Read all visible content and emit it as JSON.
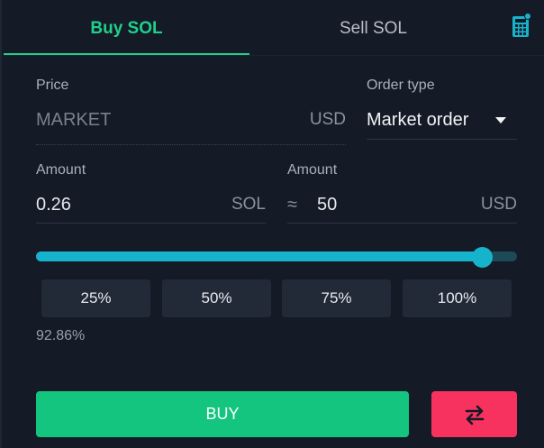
{
  "tabs": [
    {
      "label": "Buy SOL",
      "active": true
    },
    {
      "label": "Sell SOL",
      "active": false
    }
  ],
  "calculator_icon": "calculator-icon",
  "price": {
    "label": "Price",
    "value": "MARKET",
    "unit": "USD"
  },
  "order_type": {
    "label": "Order type",
    "selected": "Market order"
  },
  "amount_base": {
    "label": "Amount",
    "value": "0.26",
    "unit": "SOL"
  },
  "amount_quote": {
    "label": "Amount",
    "approx_symbol": "≈",
    "value": "50",
    "unit": "USD"
  },
  "slider": {
    "level_percent": 92.86
  },
  "percent_buttons": [
    "25%",
    "50%",
    "75%",
    "100%"
  ],
  "percent_readout": "92.86%",
  "buy_button": {
    "label": "BUY"
  },
  "swap_button": {
    "icon": "swap-arrows-icon"
  },
  "colors": {
    "background": "#141a26",
    "buy_accent": "#1fd08c",
    "slider": "#16b4cc",
    "buy_button": "#14c57f",
    "swap_button": "#f7325e"
  }
}
